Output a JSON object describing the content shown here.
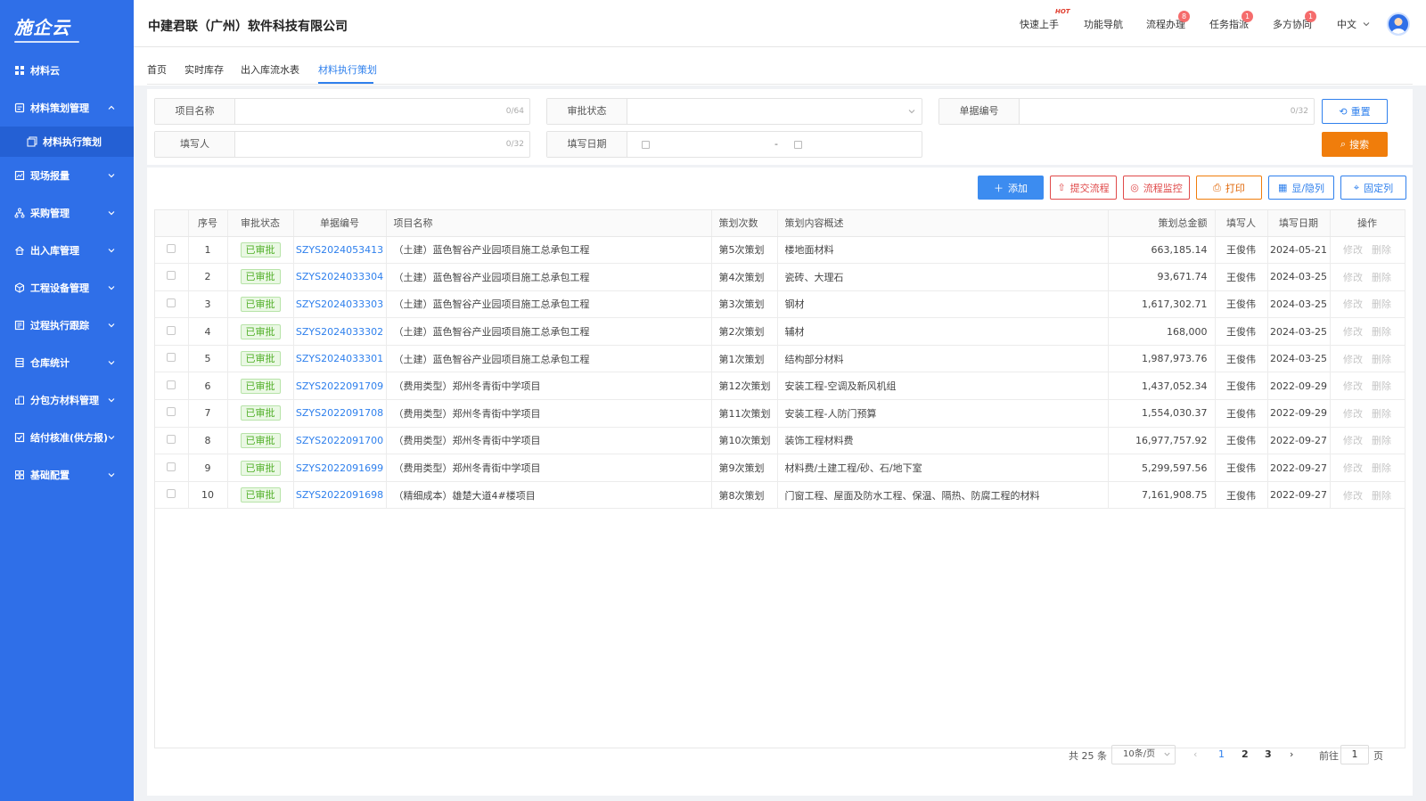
{
  "app": {
    "logo": "施企云",
    "company": "中建君联（广州）软件科技有限公司"
  },
  "sidebar": {
    "items": [
      {
        "label": "材料云",
        "icon": "grid-icon"
      },
      {
        "label": "材料策划管理",
        "icon": "clipboard-icon",
        "expanded": true
      },
      {
        "label": "材料执行策划",
        "icon": "layers-icon",
        "sub": true
      },
      {
        "label": "现场报量",
        "icon": "chart-doc-icon"
      },
      {
        "label": "采购管理",
        "icon": "sitemap-icon"
      },
      {
        "label": "出入库管理",
        "icon": "home-icon"
      },
      {
        "label": "工程设备管理",
        "icon": "cube-icon"
      },
      {
        "label": "过程执行跟踪",
        "icon": "track-icon"
      },
      {
        "label": "仓库统计",
        "icon": "stack-icon"
      },
      {
        "label": "分包方材料管理",
        "icon": "building-icon"
      },
      {
        "label": "结付核准(供方报)",
        "icon": "check-doc-icon"
      },
      {
        "label": "基础配置",
        "icon": "settings-grid-icon"
      }
    ]
  },
  "header": {
    "nav": [
      {
        "label": "快速上手",
        "hot": "HOT"
      },
      {
        "label": "功能导航"
      },
      {
        "label": "流程办理",
        "badge": "8"
      },
      {
        "label": "任务指派",
        "badge": "1"
      },
      {
        "label": "多方协同",
        "badge": "1"
      }
    ],
    "language": "中文"
  },
  "tabs": [
    "首页",
    "实时库存",
    "出入库流水表",
    "材料执行策划"
  ],
  "filter": {
    "project_name": {
      "label": "项目名称",
      "count": "0/64"
    },
    "approval_status": {
      "label": "审批状态"
    },
    "doc_no": {
      "label": "单据编号",
      "count": "0/32"
    },
    "filler": {
      "label": "填写人",
      "count": "0/32"
    },
    "fill_date": {
      "label": "填写日期",
      "sep": "-"
    },
    "reset_label": "重置",
    "search_label": "搜索"
  },
  "toolbar": {
    "add": "添加",
    "submit": "提交流程",
    "monitor": "流程监控",
    "print": "打印",
    "toggle_cols": "显/隐列",
    "fix_cols": "固定列"
  },
  "table": {
    "headers": [
      "序号",
      "审批状态",
      "单据编号",
      "项目名称",
      "策划次数",
      "策划内容概述",
      "策划总金额",
      "填写人",
      "填写日期",
      "操作"
    ],
    "rows": [
      {
        "no": "1",
        "status": "已审批",
        "code": "SZYS2024053413",
        "project": "（土建）蓝色智谷产业园项目施工总承包工程",
        "times": "第5次策划",
        "summary": "楼地面材料",
        "amount": "663,185.14",
        "filler": "王俊伟",
        "date": "2024-05-21",
        "edit": "修改",
        "del": "删除"
      },
      {
        "no": "2",
        "status": "已审批",
        "code": "SZYS2024033304",
        "project": "（土建）蓝色智谷产业园项目施工总承包工程",
        "times": "第4次策划",
        "summary": "瓷砖、大理石",
        "amount": "93,671.74",
        "filler": "王俊伟",
        "date": "2024-03-25",
        "edit": "修改",
        "del": "删除"
      },
      {
        "no": "3",
        "status": "已审批",
        "code": "SZYS2024033303",
        "project": "（土建）蓝色智谷产业园项目施工总承包工程",
        "times": "第3次策划",
        "summary": "钢材",
        "amount": "1,617,302.71",
        "filler": "王俊伟",
        "date": "2024-03-25",
        "edit": "修改",
        "del": "删除"
      },
      {
        "no": "4",
        "status": "已审批",
        "code": "SZYS2024033302",
        "project": "（土建）蓝色智谷产业园项目施工总承包工程",
        "times": "第2次策划",
        "summary": "辅材",
        "amount": "168,000",
        "filler": "王俊伟",
        "date": "2024-03-25",
        "edit": "修改",
        "del": "删除"
      },
      {
        "no": "5",
        "status": "已审批",
        "code": "SZYS2024033301",
        "project": "（土建）蓝色智谷产业园项目施工总承包工程",
        "times": "第1次策划",
        "summary": "结构部分材料",
        "amount": "1,987,973.76",
        "filler": "王俊伟",
        "date": "2024-03-25",
        "edit": "修改",
        "del": "删除"
      },
      {
        "no": "6",
        "status": "已审批",
        "code": "SZYS2022091709",
        "project": "（费用类型）郑州冬青街中学项目",
        "times": "第12次策划",
        "summary": "安装工程-空调及新风机组",
        "amount": "1,437,052.34",
        "filler": "王俊伟",
        "date": "2022-09-29",
        "edit": "修改",
        "del": "删除"
      },
      {
        "no": "7",
        "status": "已审批",
        "code": "SZYS2022091708",
        "project": "（费用类型）郑州冬青街中学项目",
        "times": "第11次策划",
        "summary": "安装工程-人防门预算",
        "amount": "1,554,030.37",
        "filler": "王俊伟",
        "date": "2022-09-29",
        "edit": "修改",
        "del": "删除"
      },
      {
        "no": "8",
        "status": "已审批",
        "code": "SZYS2022091700",
        "project": "（费用类型）郑州冬青街中学项目",
        "times": "第10次策划",
        "summary": "装饰工程材料费",
        "amount": "16,977,757.92",
        "filler": "王俊伟",
        "date": "2022-09-27",
        "edit": "修改",
        "del": "删除"
      },
      {
        "no": "9",
        "status": "已审批",
        "code": "SZYS2022091699",
        "project": "（费用类型）郑州冬青街中学项目",
        "times": "第9次策划",
        "summary": "材料费/土建工程/砂、石/地下室",
        "amount": "5,299,597.56",
        "filler": "王俊伟",
        "date": "2022-09-27",
        "edit": "修改",
        "del": "删除"
      },
      {
        "no": "10",
        "status": "已审批",
        "code": "SZYS2022091698",
        "project": "（精细成本）雄楚大道4#楼项目",
        "times": "第8次策划",
        "summary": "门窗工程、屋面及防水工程、保温、隔热、防腐工程的材料",
        "amount": "7,161,908.75",
        "filler": "王俊伟",
        "date": "2022-09-27",
        "edit": "修改",
        "del": "删除"
      }
    ]
  },
  "pagination": {
    "total": "共 25 条",
    "page_size": "10条/页",
    "pages": [
      "1",
      "2",
      "3"
    ],
    "goto_label": "前往",
    "goto_value": "1",
    "page_unit": "页"
  },
  "colors": {
    "sidebar": "#2f6fe8",
    "accent": "#2f80ed",
    "search": "#f07d0b",
    "status_green": "#52b02a"
  }
}
